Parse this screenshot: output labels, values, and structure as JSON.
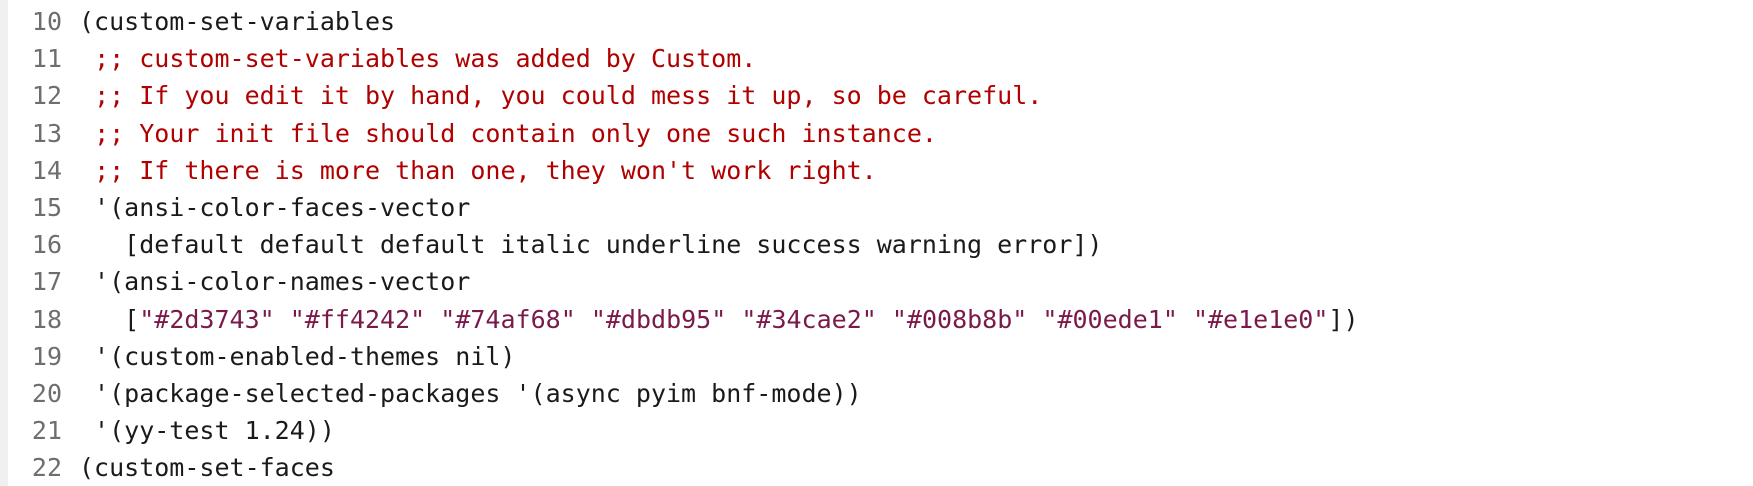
{
  "editor": {
    "colors": {
      "default": "#1a1a1a",
      "comment": "#b00000",
      "string": "#7a1a4a",
      "line_number": "#6e6e6e",
      "background": "#ffffff"
    },
    "lines": [
      {
        "number": "10",
        "tokens": [
          {
            "type": "default",
            "text": "(custom-set-variables"
          }
        ]
      },
      {
        "number": "11",
        "tokens": [
          {
            "type": "default",
            "text": " "
          },
          {
            "type": "comment",
            "text": ";; custom-set-variables was added by Custom."
          }
        ]
      },
      {
        "number": "12",
        "tokens": [
          {
            "type": "default",
            "text": " "
          },
          {
            "type": "comment",
            "text": ";; If you edit it by hand, you could mess it up, so be careful."
          }
        ]
      },
      {
        "number": "13",
        "tokens": [
          {
            "type": "default",
            "text": " "
          },
          {
            "type": "comment",
            "text": ";; Your init file should contain only one such instance."
          }
        ]
      },
      {
        "number": "14",
        "tokens": [
          {
            "type": "default",
            "text": " "
          },
          {
            "type": "comment",
            "text": ";; If there is more than one, they won't work right."
          }
        ]
      },
      {
        "number": "15",
        "tokens": [
          {
            "type": "default",
            "text": " '(ansi-color-faces-vector"
          }
        ]
      },
      {
        "number": "16",
        "tokens": [
          {
            "type": "default",
            "text": "   [default default default italic underline success warning error])"
          }
        ]
      },
      {
        "number": "17",
        "tokens": [
          {
            "type": "default",
            "text": " '(ansi-color-names-vector"
          }
        ]
      },
      {
        "number": "18",
        "tokens": [
          {
            "type": "default",
            "text": "   ["
          },
          {
            "type": "string",
            "text": "\"#2d3743\""
          },
          {
            "type": "default",
            "text": " "
          },
          {
            "type": "string",
            "text": "\"#ff4242\""
          },
          {
            "type": "default",
            "text": " "
          },
          {
            "type": "string",
            "text": "\"#74af68\""
          },
          {
            "type": "default",
            "text": " "
          },
          {
            "type": "string",
            "text": "\"#dbdb95\""
          },
          {
            "type": "default",
            "text": " "
          },
          {
            "type": "string",
            "text": "\"#34cae2\""
          },
          {
            "type": "default",
            "text": " "
          },
          {
            "type": "string",
            "text": "\"#008b8b\""
          },
          {
            "type": "default",
            "text": " "
          },
          {
            "type": "string",
            "text": "\"#00ede1\""
          },
          {
            "type": "default",
            "text": " "
          },
          {
            "type": "string",
            "text": "\"#e1e1e0\""
          },
          {
            "type": "default",
            "text": "])"
          }
        ]
      },
      {
        "number": "19",
        "tokens": [
          {
            "type": "default",
            "text": " '(custom-enabled-themes nil)"
          }
        ]
      },
      {
        "number": "20",
        "tokens": [
          {
            "type": "default",
            "text": " '(package-selected-packages '(async pyim bnf-mode))"
          }
        ]
      },
      {
        "number": "21",
        "tokens": [
          {
            "type": "default",
            "text": " '(yy-test 1.24))"
          }
        ]
      },
      {
        "number": "22",
        "tokens": [
          {
            "type": "default",
            "text": "(custom-set-faces"
          }
        ]
      }
    ]
  }
}
